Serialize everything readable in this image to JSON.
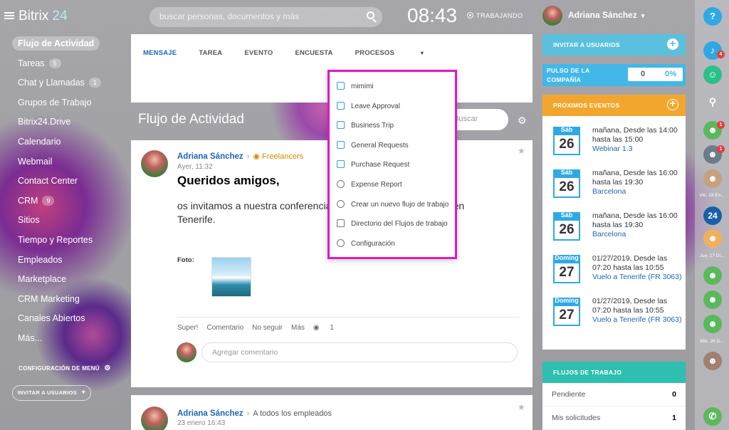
{
  "header": {
    "logo_a": "Bitrix",
    "logo_b": "24",
    "search_placeholder": "buscar personas, documentos y más",
    "clock": "08:43",
    "work_status": "TRABAJANDO",
    "user_name": "Adriana Sánchez"
  },
  "sidebar": {
    "items": [
      {
        "label": "Flujo de Actividad",
        "count": ""
      },
      {
        "label": "Tareas",
        "count": "5"
      },
      {
        "label": "Chat y Llamadas",
        "count": "1"
      },
      {
        "label": "Grupos de Trabajo",
        "count": ""
      },
      {
        "label": "Bitrix24.Drive",
        "count": ""
      },
      {
        "label": "Calendario",
        "count": ""
      },
      {
        "label": "Webmail",
        "count": ""
      },
      {
        "label": "Contact Center",
        "count": ""
      },
      {
        "label": "CRM",
        "count": "9"
      },
      {
        "label": "Sitios",
        "count": ""
      },
      {
        "label": "Tiempo y Reportes",
        "count": ""
      },
      {
        "label": "Empleados",
        "count": ""
      },
      {
        "label": "Marketplace",
        "count": ""
      },
      {
        "label": "CRM Marketing",
        "count": ""
      },
      {
        "label": "Canales Abiertos",
        "count": ""
      },
      {
        "label": "Más...",
        "count": ""
      }
    ],
    "config_label": "CONFIGURACIÓN DE MENÚ",
    "invite_label": "INVITAR A USUARIOS"
  },
  "composer": {
    "tabs": [
      "MENSAJE",
      "TAREA",
      "EVENTO",
      "ENCUESTA",
      "PROCESOS"
    ]
  },
  "feed": {
    "title": "Flujo de Actividad",
    "search_placeholder": "Buscar"
  },
  "post": {
    "author": "Adriana Sánchez",
    "group": "Freelancers",
    "time": "Ayer, 11:32",
    "headline": "Queridos amigos,",
    "body": "os invitamos a nuestra conferencia que se celebrará en enero en Tenerife.",
    "photo_label": "Foto:",
    "actions": [
      "Super!",
      "Comentario",
      "No seguir",
      "Más"
    ],
    "views": "1",
    "comment_placeholder": "Agregar comentario"
  },
  "post2": {
    "author": "Adriana Sánchez",
    "audience": "A todos los empleados",
    "time": "23 enero 16:43"
  },
  "dropdown": {
    "items": [
      "mimimi",
      "Leave Approval",
      "Business Trip",
      "General Requests",
      "Purchase Request",
      "Expense Report",
      "Crear un nuevo flujo de trabajo",
      "Directorio del Flujos de trabajo",
      "Configuración"
    ]
  },
  "right": {
    "invite": "INVITAR A USUARIOS",
    "pulse_a": "PULSO DE LA",
    "pulse_b": "COMPAÑÍA",
    "pulse_val": "0",
    "pulse_pct": "0%",
    "events_title": "PRÓXIMOS EVENTOS",
    "events": [
      {
        "day": "Sáb",
        "num": "26",
        "text": "mañana, Desde las 14:00 hasta las 15:00",
        "link": "Webinar 1.3"
      },
      {
        "day": "Sáb",
        "num": "26",
        "text": "mañana, Desde las 16:00 hasta las 19:30",
        "link": "Barcelona"
      },
      {
        "day": "Sáb",
        "num": "26",
        "text": "mañana, Desde las 16:00 hasta las 19:30",
        "link": "Barcelona"
      },
      {
        "day": "Doming",
        "num": "27",
        "text": "01/27/2019, Desde las 07:20 hasta las 10:55",
        "link": "Vuelo a Tenerife (FR 3063)"
      },
      {
        "day": "Doming",
        "num": "27",
        "text": "01/27/2019, Desde las 07:20 hasta las 10:55",
        "link": "Vuelo a Tenerife (FR 3063)"
      }
    ],
    "flows_title": "FLUJOS DE TRABAJO",
    "flows": [
      {
        "label": "Pendiente",
        "value": "0"
      },
      {
        "label": "Mis solicitudes",
        "value": "1"
      }
    ]
  },
  "rail": {
    "help": "?",
    "notif_count": "4",
    "badge1": "1",
    "badge2": "1",
    "date1": "Vie, 18 En...",
    "date2": "Jue, 27 Di...",
    "date3": "Mié, 26 D...",
    "b24": "24"
  }
}
